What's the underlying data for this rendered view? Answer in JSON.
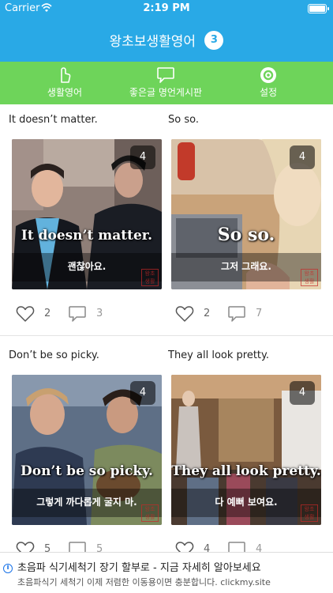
{
  "status": {
    "carrier": "Carrier",
    "time": "2:19 PM"
  },
  "nav": {
    "title": "왕초보생활영어",
    "badge": "3"
  },
  "tabs": [
    {
      "label": "생활영어",
      "icon": "hand-tap-icon"
    },
    {
      "label": "좋은글 명언게시판",
      "icon": "speech-bubble-icon"
    },
    {
      "label": "설정",
      "icon": "gear-icon"
    }
  ],
  "cards": [
    {
      "title": "It doesn’t matter.",
      "caption_en": "It doesn’t matter.",
      "caption_ko": "괜찮아요.",
      "count": "4",
      "likes": "2",
      "comments": "3"
    },
    {
      "title": "So so.",
      "caption_en": "So so.",
      "caption_ko": "그저 그래요.",
      "count": "4",
      "likes": "2",
      "comments": "7"
    },
    {
      "title": "Don’t be so picky.",
      "caption_en": "Don’t be so picky.",
      "caption_ko": "그렇게 까다롭게 굴지 마.",
      "count": "4",
      "likes": "5",
      "comments": "5"
    },
    {
      "title": "They all look pretty.",
      "caption_en": "They all look pretty.",
      "caption_ko": "다 예뻐 보여요.",
      "count": "4",
      "likes": "4",
      "comments": "4"
    }
  ],
  "ad": {
    "title": "초음파 식기세척기 장기 할부로 - 지금 자세히 알아보세요",
    "subtitle": "초음파식기 세척기 이제 저렴한 이동용이면 충분합니다. clickmy.site"
  },
  "colors": {
    "nav_blue": "#29a9e6",
    "tab_green": "#6ed45a"
  }
}
